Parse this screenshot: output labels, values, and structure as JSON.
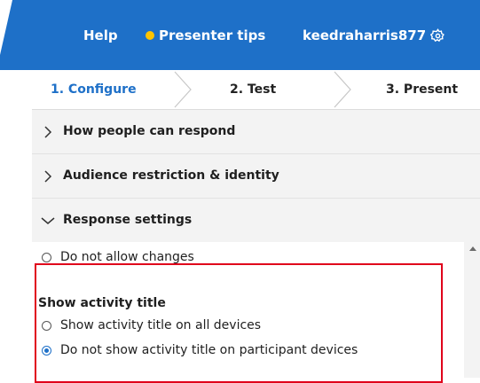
{
  "header": {
    "help_label": "Help",
    "tips_label": "Presenter tips",
    "username": "keedraharris877",
    "user_icon": "gear-icon",
    "tips_icon": "yellow-dot",
    "brand_color": "#1e70c8"
  },
  "stepper": {
    "steps": [
      {
        "label": "1. Configure",
        "active": true
      },
      {
        "label": "2. Test",
        "active": false
      },
      {
        "label": "3. Present",
        "active": false
      }
    ]
  },
  "accordion": {
    "items": [
      {
        "label": "How people can respond",
        "expanded": false
      },
      {
        "label": "Audience restriction & identity",
        "expanded": false
      },
      {
        "label": "Response settings",
        "expanded": true
      }
    ]
  },
  "response_settings": {
    "changes_option": {
      "label": "Do not allow changes",
      "selected": false
    },
    "activity_title": {
      "heading": "Show activity title",
      "options": [
        {
          "label": "Show activity title on all devices",
          "selected": false
        },
        {
          "label": "Do not show activity title on participant devices",
          "selected": true
        }
      ]
    }
  },
  "colors": {
    "accent": "#1e70c8",
    "highlight": "#e0001b",
    "tips_dot": "#ffc400"
  }
}
